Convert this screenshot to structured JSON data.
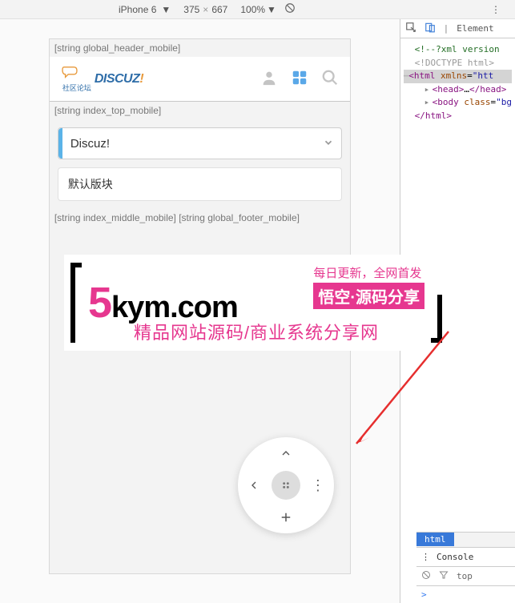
{
  "toolbar": {
    "device": "iPhone 6",
    "width": "375",
    "height": "667",
    "zoom": "100%"
  },
  "placeholders": {
    "header": "[string global_header_mobile]",
    "top": "[string index_top_mobile]",
    "middle_footer": "[string index_middle_mobile] [string global_footer_mobile]"
  },
  "logo": {
    "text": "DISCUZ",
    "exclaim": "!",
    "subtitle": "社区论坛"
  },
  "forum": {
    "category": "Discuz!",
    "board": "默认版块"
  },
  "watermark": {
    "domain_five": "5",
    "domain_rest": "kym.com",
    "tag1": "每日更新，全网首发",
    "tag2": "悟空·源码分享",
    "bottom": "精品网站源码/商业系统分享网"
  },
  "devtools": {
    "tab_elements": "Element",
    "xml_decl": "<!--?xml version",
    "doctype": "<!DOCTYPE html>",
    "html_open": "html",
    "xmlns_attr": "xmlns",
    "xmlns_val": "\"htt",
    "head_tag": "head",
    "head_ellipsis": "…",
    "body_tag": "body",
    "class_attr": "class",
    "class_val": "\"bg",
    "html_close": "/html",
    "crumb": "html",
    "console_tab": "Console",
    "filter_top": "top",
    "prompt": ">"
  }
}
